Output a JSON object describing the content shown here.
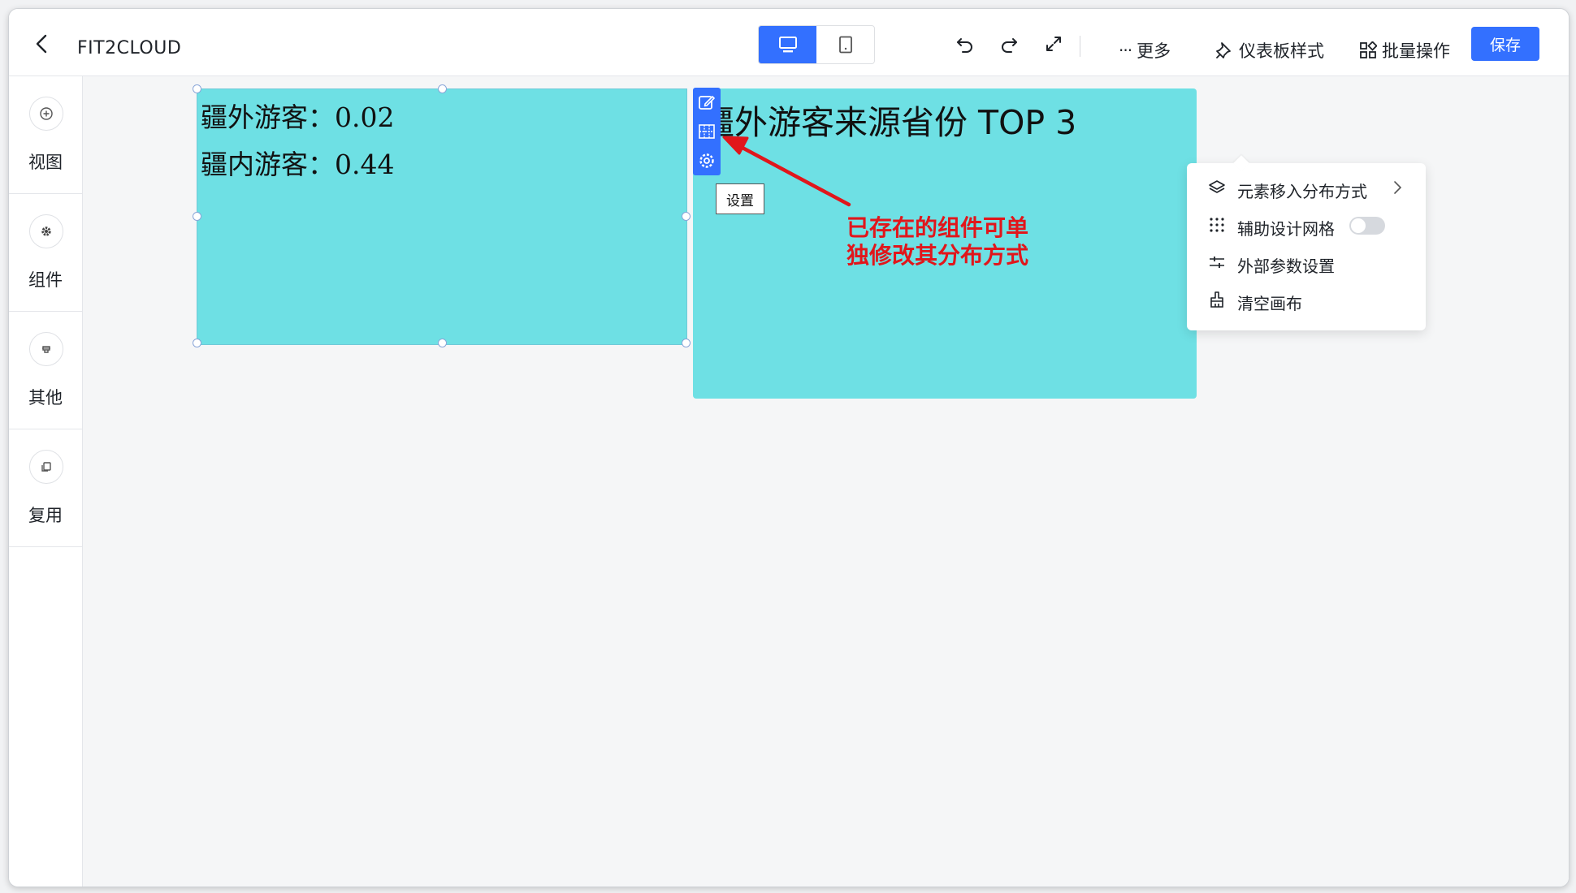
{
  "header": {
    "title": "FIT2CLOUD",
    "more_label": "更多",
    "style_label": "仪表板样式",
    "batch_label": "批量操作",
    "save_label": "保存"
  },
  "sidebar": {
    "items": [
      {
        "label": "视图",
        "icon": "plus-circle-icon"
      },
      {
        "label": "组件",
        "icon": "gear-icon"
      },
      {
        "label": "其他",
        "icon": "stamp-icon"
      },
      {
        "label": "复用",
        "icon": "copy-icon"
      }
    ]
  },
  "canvas": {
    "component1": {
      "line1": "疆外游客：0.02",
      "line2": "疆内游客：0.44"
    },
    "component2": {
      "title": "疆外游客来源省份 TOP 3"
    },
    "tooltip": "设置",
    "annotation": {
      "line1": "已存在的组件可单",
      "line2": "独修改其分布方式"
    }
  },
  "menu": {
    "items": [
      {
        "label": "元素移入分布方式",
        "icon": "layers-icon"
      },
      {
        "label": "辅助设计网格",
        "icon": "grid-dots-icon"
      },
      {
        "label": "外部参数设置",
        "icon": "sliders-icon"
      },
      {
        "label": "清空画布",
        "icon": "broom-icon"
      }
    ],
    "grid_switch_on": false
  },
  "colors": {
    "accent": "#3370ff",
    "component_bg": "#6ee0e4",
    "annotation": "#e1161b"
  }
}
